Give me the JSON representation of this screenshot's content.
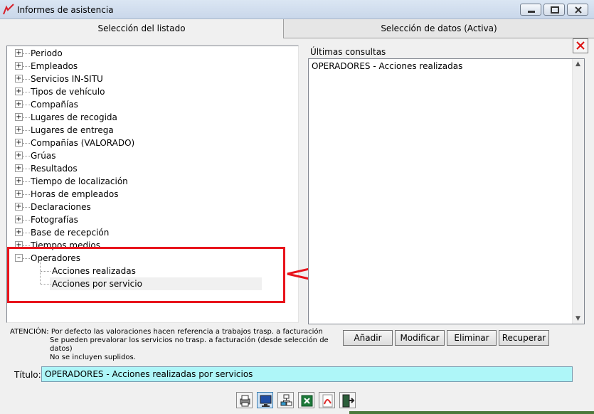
{
  "window": {
    "title": "Informes de asistencia"
  },
  "tabs": [
    {
      "label": "Selección del listado"
    },
    {
      "label": "Selección de datos (Activa)"
    }
  ],
  "tree": {
    "items": [
      {
        "label": "Periodo"
      },
      {
        "label": "Empleados"
      },
      {
        "label": "Servicios IN-SITU"
      },
      {
        "label": "Tipos de vehículo"
      },
      {
        "label": "Compañías"
      },
      {
        "label": "Lugares de recogida"
      },
      {
        "label": "Lugares de entrega"
      },
      {
        "label": "Compañías (VALORADO)"
      },
      {
        "label": "Grúas"
      },
      {
        "label": "Resultados"
      },
      {
        "label": "Tiempo de localización"
      },
      {
        "label": "Horas de empleados"
      },
      {
        "label": "Declaraciones"
      },
      {
        "label": "Fotografías"
      },
      {
        "label": "Base de recepción"
      },
      {
        "label": "Tiempos medios"
      }
    ],
    "expanded": {
      "label": "Operadores",
      "children": [
        {
          "label": "Acciones realizadas"
        },
        {
          "label": "Acciones por servicio",
          "selected": true
        }
      ]
    }
  },
  "consultas": {
    "label": "Últimas consultas",
    "items": [
      "OPERADORES - Acciones realizadas"
    ]
  },
  "note": {
    "prefix": "ATENCIÓN:",
    "line1": "Por defecto las valoraciones hacen referencia a trabajos trasp. a facturación",
    "line2": "Se pueden prevalorar los servicios no trasp. a facturación (desde selección de datos)",
    "line3": "No se incluyen suplidos."
  },
  "actions": {
    "add": "Añadir",
    "modify": "Modificar",
    "delete": "Eliminar",
    "recover": "Recuperar"
  },
  "titulo": {
    "label": "Título:",
    "value": "OPERADORES - Acciones realizadas por servicios"
  },
  "toolbar": {
    "icons": [
      "print-icon",
      "screen-preview-icon",
      "tree-structure-icon",
      "excel-icon",
      "pdf-icon",
      "exit-door-icon"
    ]
  },
  "colors": {
    "title_field_bg": "#aef6f8",
    "highlight": "#e8141c"
  }
}
